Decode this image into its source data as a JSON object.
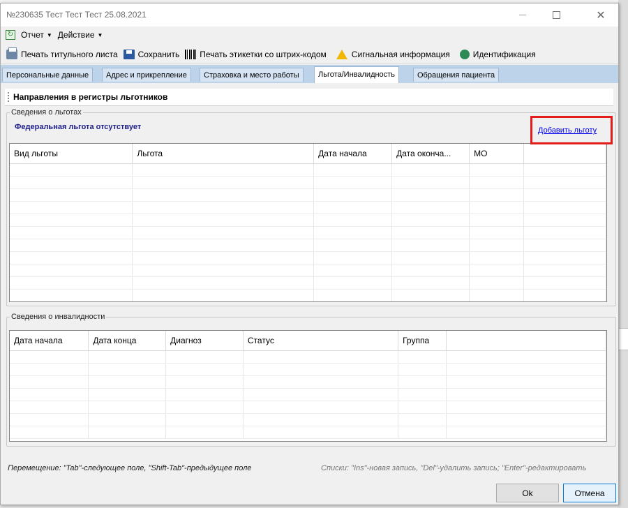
{
  "window": {
    "title": "№230635 Тест Тест Тест 25.08.2021"
  },
  "menu": {
    "items": [
      {
        "label": "Отчет"
      },
      {
        "label": "Действие"
      }
    ]
  },
  "toolbar": {
    "print_title": "Печать титульного листа",
    "save": "Сохранить",
    "print_barcode": "Печать этикетки со штрих-кодом",
    "signal_info": "Сигнальная информация",
    "identification": "Идентификация"
  },
  "tabs": [
    {
      "label": "Персональные данные",
      "active": false
    },
    {
      "label": "Адрес и прикрепление",
      "active": false
    },
    {
      "label": "Страховка и место работы",
      "active": false
    },
    {
      "label": "Льгота/Инвалидность",
      "active": true
    },
    {
      "label": "Обращения пациента",
      "active": false
    }
  ],
  "registry_header": "Направления в регистры льготников",
  "benefits": {
    "legend": "Сведения о льготах",
    "federal_status": "Федеральная льгота отсутствует",
    "add_link": "Добавить льготу",
    "columns": [
      "Вид льготы",
      "Льгота",
      "Дата начала",
      "Дата оконча...",
      "МО",
      ""
    ]
  },
  "disability": {
    "legend": "Сведения о инвалидности",
    "columns": [
      "Дата начала",
      "Дата конца",
      "Диагноз",
      "Статус",
      "Группа",
      ""
    ]
  },
  "hints": {
    "navigation": "Перемещение: \"Tab\"-следующее поле, \"Shift-Tab\"-предыдущее поле",
    "lists": "Списки: \"Ins\"-новая запись, \"Del\"-удалить запись; \"Enter\"-редактировать"
  },
  "buttons": {
    "ok": "Ok",
    "cancel": "Отмена"
  },
  "colors": {
    "tab_bar": "#bcd3ea",
    "link": "#0000ee",
    "highlight": "#e21b1b",
    "federal_text": "#1e1e8a"
  }
}
